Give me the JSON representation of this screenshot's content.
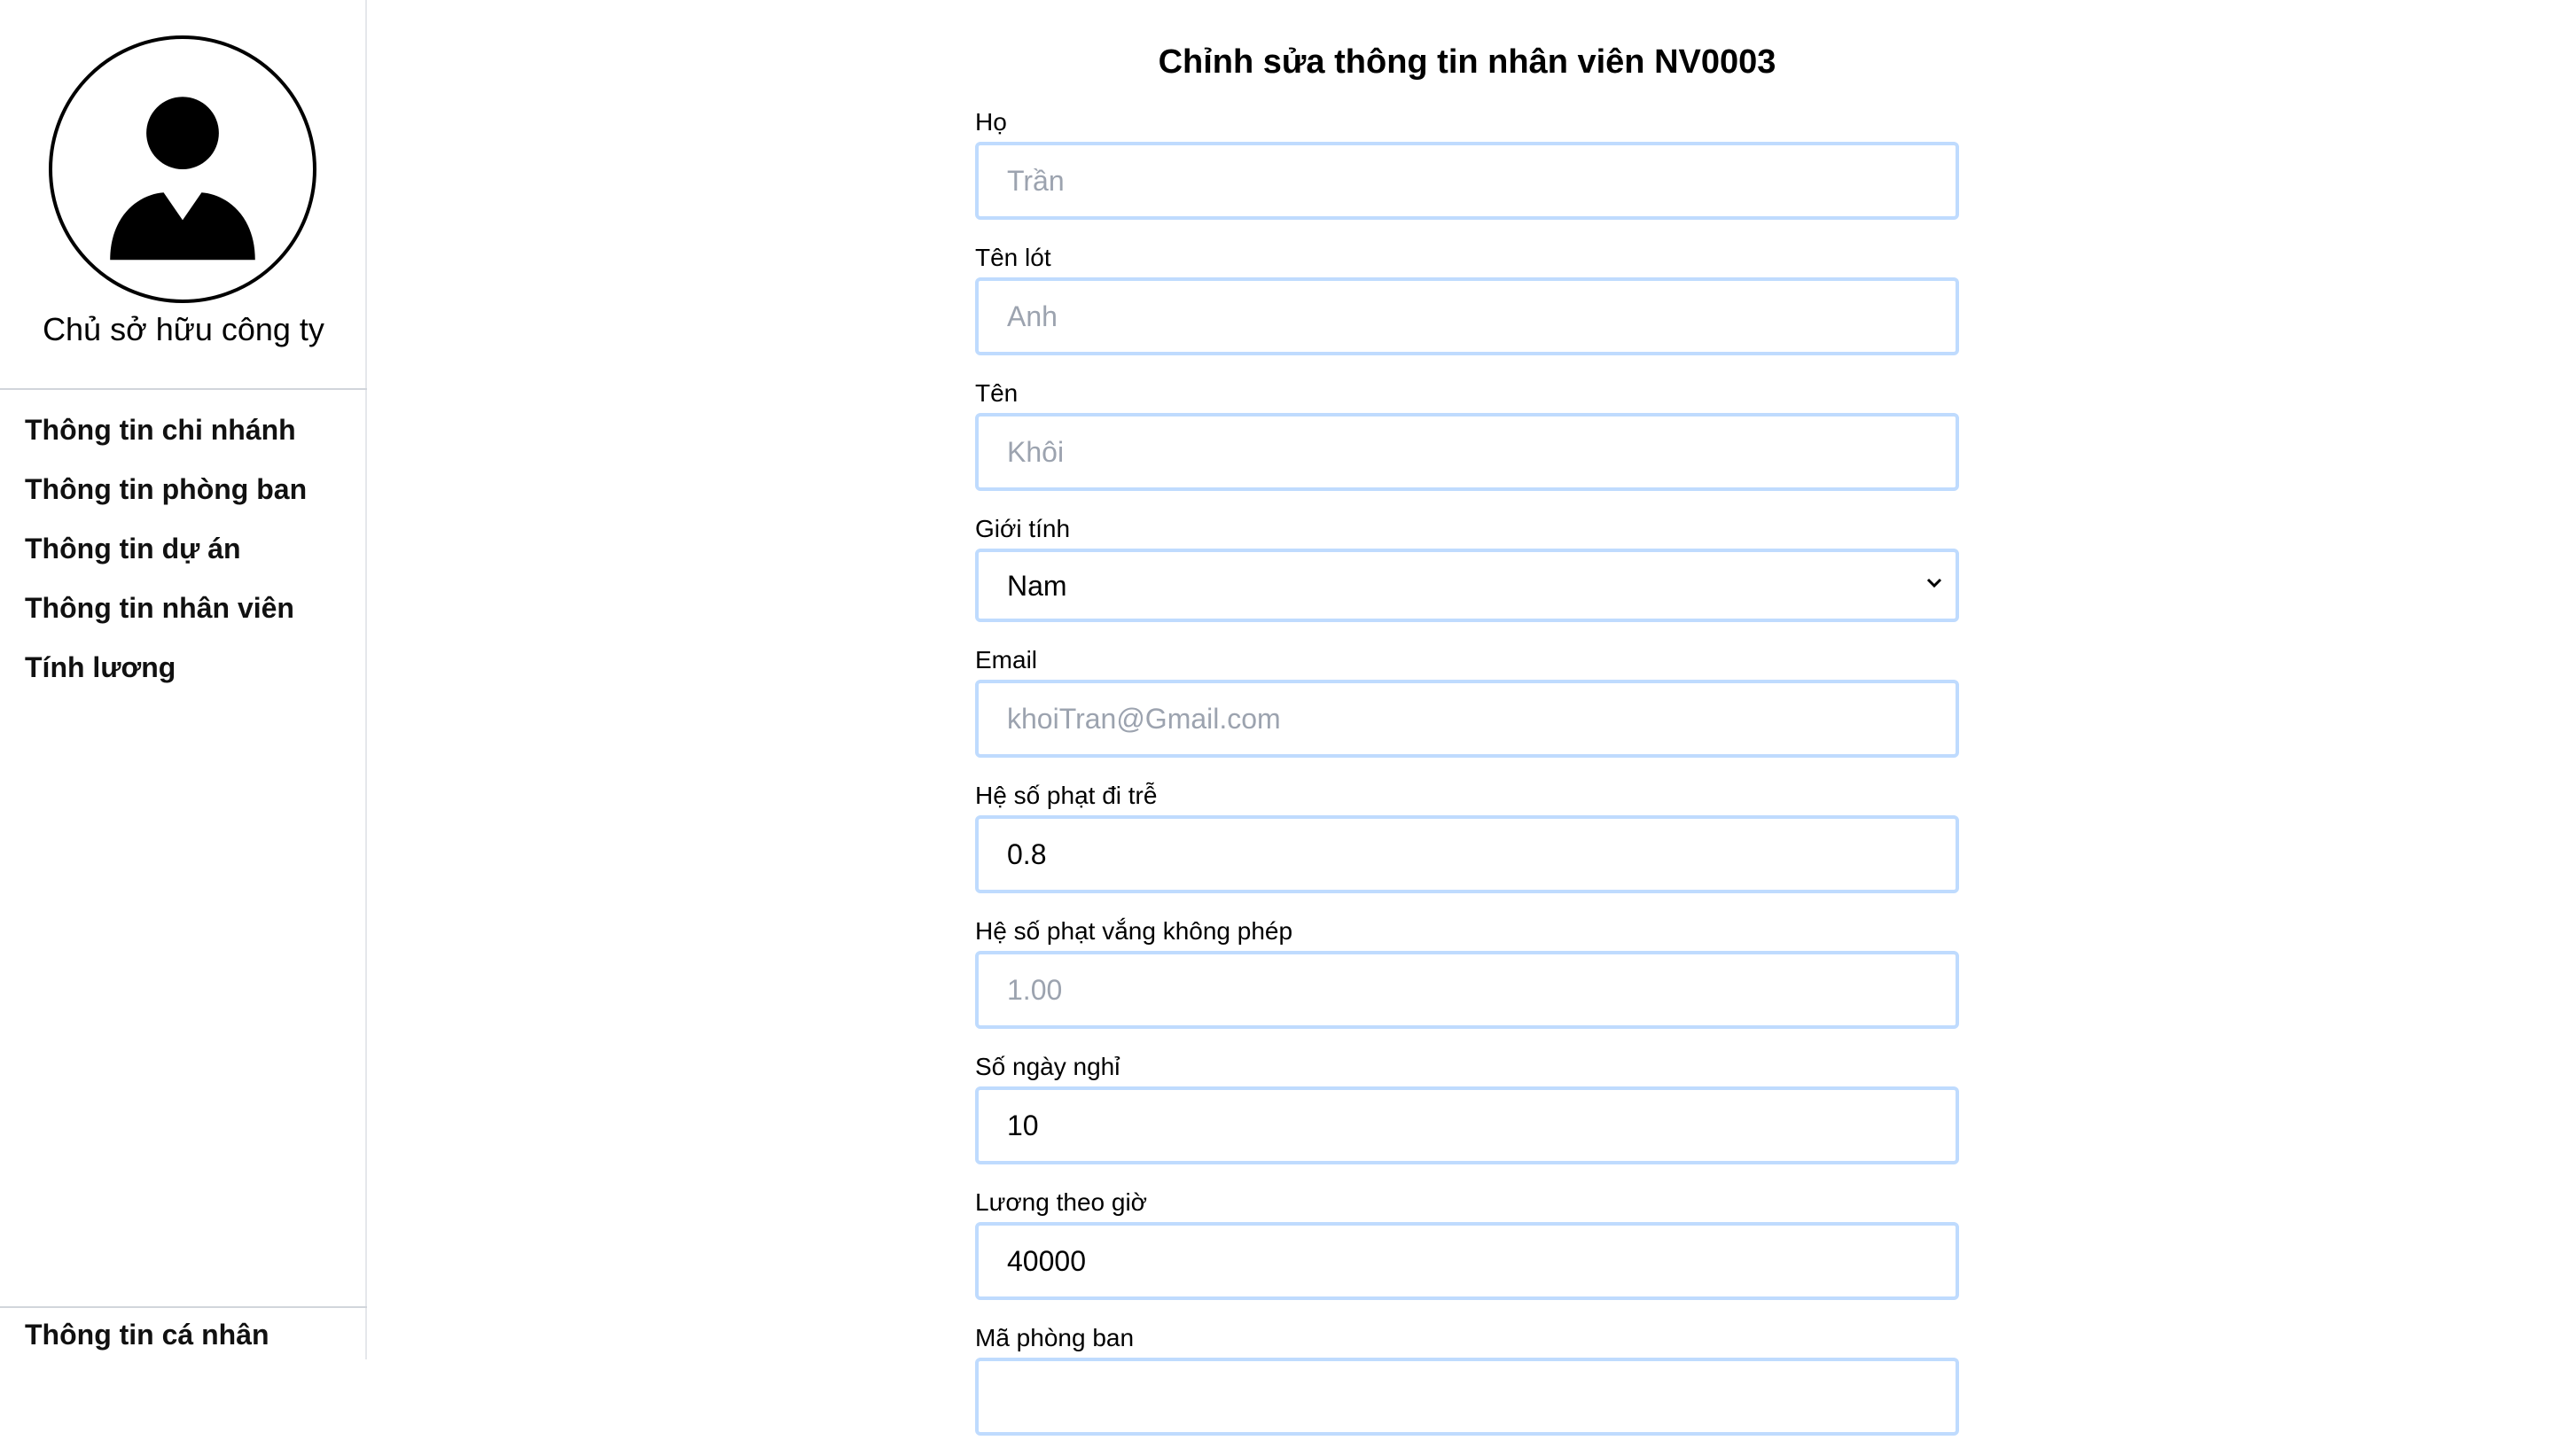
{
  "sidebar": {
    "avatar_icon": "user-avatar-icon",
    "role": "Chủ sở hữu công ty",
    "nav": [
      {
        "label": "Thông tin chi nhánh"
      },
      {
        "label": "Thông tin phòng ban"
      },
      {
        "label": "Thông tin dự án"
      },
      {
        "label": "Thông tin nhân viên"
      },
      {
        "label": "Tính lương"
      }
    ],
    "profile_label": "Thông tin cá nhân"
  },
  "main": {
    "title": "Chỉnh sửa thông tin nhân viên NV0003",
    "fields": {
      "ho": {
        "label": "Họ",
        "value": "",
        "placeholder": "Trần"
      },
      "ten_lot": {
        "label": "Tên lót",
        "value": "",
        "placeholder": "Anh"
      },
      "ten": {
        "label": "Tên",
        "value": "",
        "placeholder": "Khôi"
      },
      "gioi_tinh": {
        "label": "Giới tính",
        "selected": "Nam",
        "icon": "chevron-down-icon"
      },
      "email": {
        "label": "Email",
        "value": "",
        "placeholder": "khoiTran@Gmail.com"
      },
      "he_so_di_tre": {
        "label": "Hệ số phạt đi trễ",
        "value": "0.8",
        "placeholder": ""
      },
      "he_so_vang": {
        "label": "Hệ số phạt vắng không phép",
        "value": "",
        "placeholder": "1.00"
      },
      "so_ngay_nghi": {
        "label": "Số ngày nghỉ",
        "value": "10",
        "placeholder": ""
      },
      "luong_theo_gio": {
        "label": "Lương theo giờ",
        "value": "40000",
        "placeholder": ""
      },
      "ma_phong_ban": {
        "label": "Mã phòng ban"
      }
    }
  },
  "colors": {
    "input_border": "#bfdbfe",
    "placeholder": "#9ca3af",
    "divider": "#d1d5db"
  }
}
